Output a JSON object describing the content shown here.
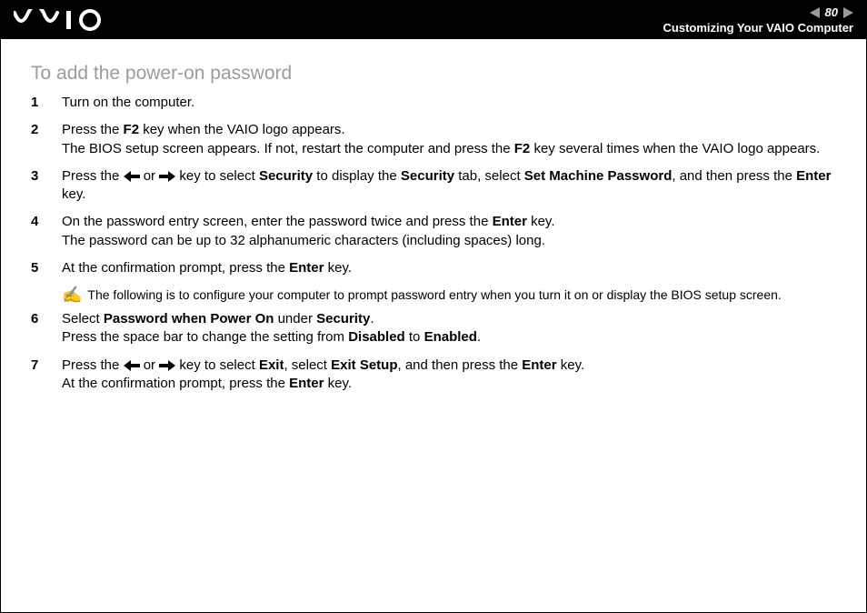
{
  "header": {
    "page_number": "80",
    "section_title": "Customizing Your VAIO Computer"
  },
  "title": "To add the power-on password",
  "steps": [
    {
      "n": "1",
      "parts": [
        {
          "t": "Turn on the computer."
        }
      ]
    },
    {
      "n": "2",
      "parts": [
        {
          "t": "Press the "
        },
        {
          "b": "F2"
        },
        {
          "t": " key when the VAIO logo appears."
        },
        {
          "br": true
        },
        {
          "t": "The BIOS setup screen appears. If not, restart the computer and press the "
        },
        {
          "b": "F2"
        },
        {
          "t": " key several times when the VAIO logo appears."
        }
      ]
    },
    {
      "n": "3",
      "parts": [
        {
          "t": "Press the "
        },
        {
          "arrow": "left"
        },
        {
          "t": " or "
        },
        {
          "arrow": "right"
        },
        {
          "t": " key to select "
        },
        {
          "b": "Security"
        },
        {
          "t": " to display the "
        },
        {
          "b": "Security"
        },
        {
          "t": " tab, select "
        },
        {
          "b": "Set Machine Password"
        },
        {
          "t": ", and then press the "
        },
        {
          "b": "Enter"
        },
        {
          "t": " key."
        }
      ]
    },
    {
      "n": "4",
      "parts": [
        {
          "t": "On the password entry screen, enter the password twice and press the "
        },
        {
          "b": "Enter"
        },
        {
          "t": " key."
        },
        {
          "br": true
        },
        {
          "t": "The password can be up to 32 alphanumeric characters (including spaces) long."
        }
      ]
    },
    {
      "n": "5",
      "parts": [
        {
          "t": "At the confirmation prompt, press the "
        },
        {
          "b": "Enter"
        },
        {
          "t": " key."
        }
      ]
    }
  ],
  "note": "The following is to configure your computer to prompt password entry when you turn it on or display the BIOS setup screen.",
  "steps2": [
    {
      "n": "6",
      "parts": [
        {
          "t": "Select "
        },
        {
          "b": "Password when Power On"
        },
        {
          "t": " under "
        },
        {
          "b": "Security"
        },
        {
          "t": "."
        },
        {
          "br": true
        },
        {
          "t": "Press the space bar to change the setting from "
        },
        {
          "b": "Disabled"
        },
        {
          "t": " to "
        },
        {
          "b": "Enabled"
        },
        {
          "t": "."
        }
      ]
    },
    {
      "n": "7",
      "parts": [
        {
          "t": "Press the "
        },
        {
          "arrow": "left"
        },
        {
          "t": " or "
        },
        {
          "arrow": "right"
        },
        {
          "t": " key to select "
        },
        {
          "b": "Exit"
        },
        {
          "t": ", select "
        },
        {
          "b": "Exit Setup"
        },
        {
          "t": ", and then press the "
        },
        {
          "b": "Enter"
        },
        {
          "t": " key."
        },
        {
          "br": true
        },
        {
          "t": "At the confirmation prompt, press the "
        },
        {
          "b": "Enter"
        },
        {
          "t": " key."
        }
      ]
    }
  ]
}
